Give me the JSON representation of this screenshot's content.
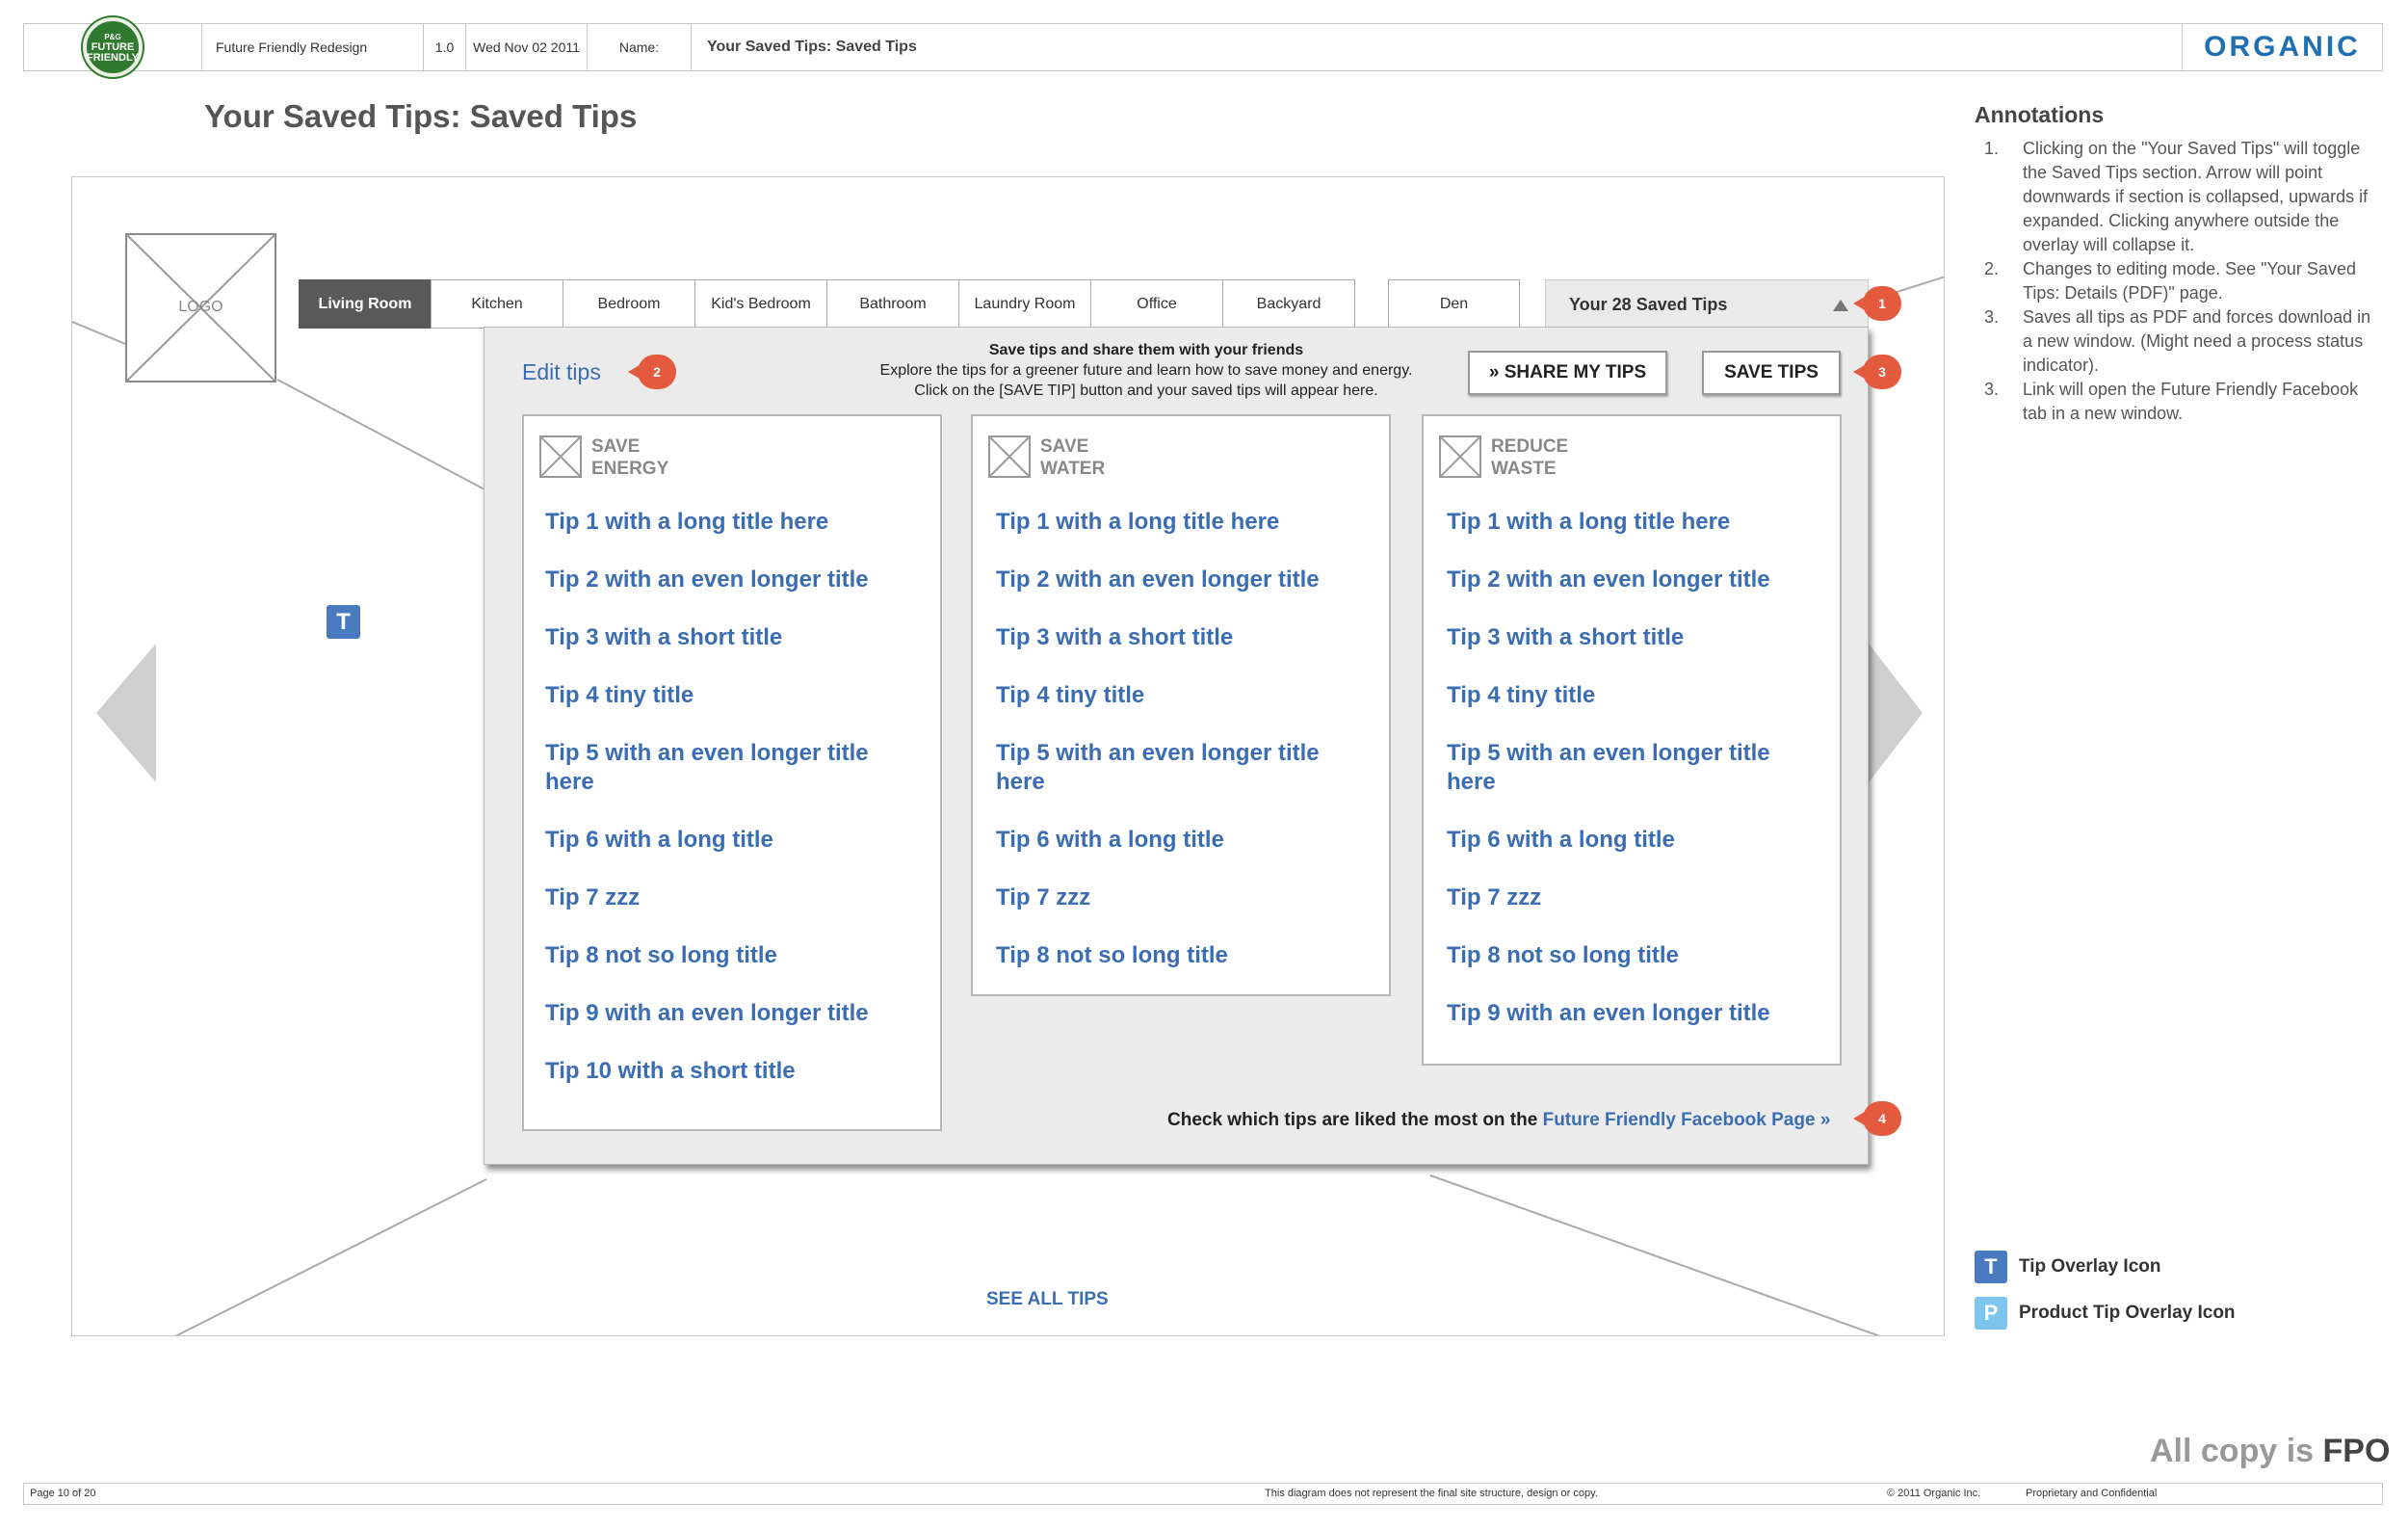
{
  "header": {
    "brand_badge": [
      "P&G",
      "FUTURE",
      "FRIENDLY"
    ],
    "project": "Future Friendly Redesign",
    "version": "1.0",
    "date": "Wed Nov 02 2011",
    "name_label": "Name:",
    "name_value": "Your Saved Tips: Saved Tips",
    "agency_logo": "ORGANIC"
  },
  "page_title": "Your Saved Tips: Saved Tips",
  "wireframe": {
    "logo_label": "LOGO",
    "tabs": [
      "Living Room",
      "Kitchen",
      "Bedroom",
      "Kid's Bedroom",
      "Bathroom",
      "Laundry Room",
      "Office",
      "Backyard"
    ],
    "tab_den": "Den",
    "saved_tips_tab": "Your 28 Saved Tips",
    "tip_icon_letter": "T",
    "see_all": "SEE ALL TIPS"
  },
  "overlay": {
    "edit_tips": "Edit tips",
    "intro_heading": "Save tips and share them with your friends",
    "intro_line1": "Explore the tips for a greener future and learn how to save money and energy.",
    "intro_line2": "Click on the [SAVE TIP] button and your saved tips will appear here.",
    "share_button": "» SHARE MY TIPS",
    "save_button": "SAVE TIPS",
    "columns": [
      {
        "title_line1": "SAVE",
        "title_line2": "ENERGY",
        "tips": [
          "Tip 1 with a long title here",
          "Tip 2 with an even longer title",
          "Tip 3 with a short title",
          "Tip 4 tiny title",
          "Tip 5 with an even longer title here",
          "Tip 6 with a long title",
          "Tip 7 zzz",
          "Tip 8 not so long title",
          "Tip 9 with an even longer title",
          "Tip 10 with a short title"
        ]
      },
      {
        "title_line1": "SAVE",
        "title_line2": "WATER",
        "tips": [
          "Tip 1 with a long title here",
          "Tip 2 with an even longer title",
          "Tip 3 with a short title",
          "Tip 4 tiny title",
          "Tip 5 with an even longer title here",
          "Tip 6 with a long title",
          "Tip 7 zzz",
          "Tip 8 not so long title"
        ]
      },
      {
        "title_line1": "REDUCE",
        "title_line2": "WASTE",
        "tips": [
          "Tip 1 with a long title here",
          "Tip 2 with an even longer title",
          "Tip 3 with a short title",
          "Tip 4 tiny title",
          "Tip 5 with an even longer title here",
          "Tip 6 with a long title",
          "Tip 7 zzz",
          "Tip 8 not so long title",
          "Tip 9 with an even longer title"
        ]
      }
    ],
    "fb_text": "Check which tips are liked the most on the ",
    "fb_link": "Future Friendly Facebook Page »"
  },
  "callouts": [
    "1",
    "2",
    "3",
    "4"
  ],
  "annotations": {
    "title": "Annotations",
    "items": [
      {
        "num": "1.",
        "text": "Clicking on the \"Your Saved Tips\" will toggle the Saved Tips section. Arrow will point downwards if section is collapsed, upwards if expanded. Clicking anywhere outside the overlay will collapse it."
      },
      {
        "num": "2.",
        "text": "Changes to editing mode. See \"Your Saved Tips: Details (PDF)\" page."
      },
      {
        "num": "3.",
        "text": "Saves all tips as PDF and forces download in a new window. (Might need a process status indicator)."
      },
      {
        "num": "3.",
        "text": "Link will open the Future Friendly Facebook tab in a new window."
      }
    ]
  },
  "legend": [
    {
      "letter": "T",
      "label": "Tip Overlay Icon",
      "color": "#4a7bc1"
    },
    {
      "letter": "P",
      "label": "Product Tip Overlay Icon",
      "color": "#7cc6ee"
    }
  ],
  "fpo": {
    "prefix": "All copy is ",
    "word": "FPO"
  },
  "footer": {
    "page": "Page 10 of 20",
    "disclaimer": "This diagram does not represent the final site structure, design or copy.",
    "copyright": "© 2011 Organic Inc.",
    "confidential": "Proprietary and Confidential"
  },
  "colors": {
    "link_blue": "#3b6db2",
    "callout_red": "#e45a3e",
    "tab_active": "#595959",
    "brand_green": "#2f7a2e",
    "organic_blue": "#1f6fb3"
  }
}
